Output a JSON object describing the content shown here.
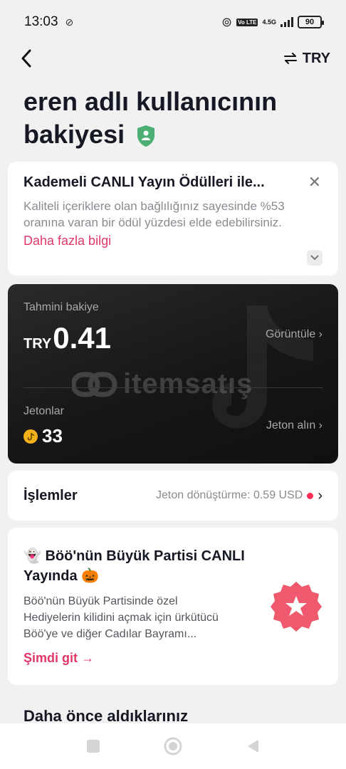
{
  "status_bar": {
    "time": "13:03",
    "network": "4.5G",
    "lte_label": "Vo LTE",
    "battery": "90"
  },
  "header": {
    "currency": "TRY"
  },
  "title": {
    "text": "eren adlı kullanıcının bakiyesi"
  },
  "promo": {
    "title": "Kademeli CANLI Yayın Ödülleri ile...",
    "text": "Kaliteli içeriklere olan bağlılığınız sayesinde %53 oranına varan bir ödül yüzdesi elde edebilirsiniz.",
    "link": "Daha fazla bilgi"
  },
  "balance": {
    "label": "Tahmini bakiye",
    "currency": "TRY",
    "value": "0.41",
    "view_label": "Görüntüle ›",
    "coins_label": "Jetonlar",
    "coins_value": "33",
    "get_coins_label": "Jeton alın ›",
    "watermark": "itemsatış"
  },
  "transactions": {
    "title": "İşlemler",
    "conversion": "Jeton dönüştürme: 0.59 USD",
    "arrow": "›"
  },
  "event": {
    "title": "👻 Böö'nün Büyük Partisi CANLI Yayında 🎃",
    "text": "Böö'nün Büyük Partisinde özel Hediyelerin kilidini açmak için ürkütücü Böö'ye ve diğer Cadılar Bayramı...",
    "link": "Şimdi git →"
  },
  "section": {
    "previous_title": "Daha önce aldıklarınız"
  },
  "colors": {
    "accent": "#e03668",
    "badge": "#f05a6e",
    "shield": "#4caf73",
    "coin": "#f3b21a"
  }
}
